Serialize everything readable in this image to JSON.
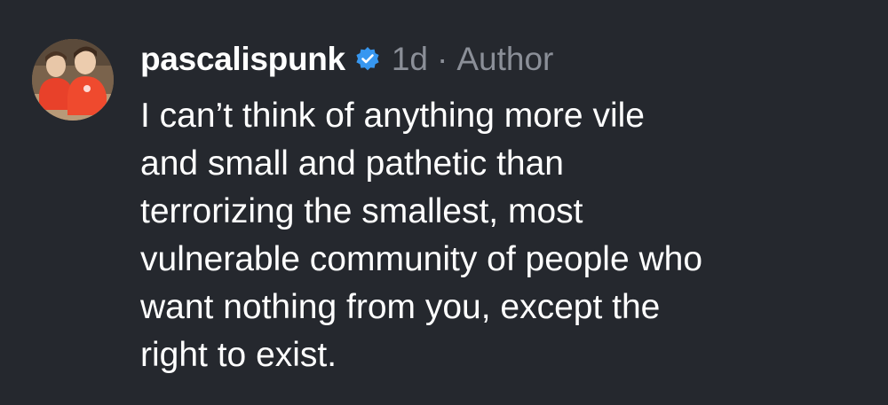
{
  "comment": {
    "username": "pascalispunk",
    "verified_icon": "verified-badge-icon",
    "time": "1d",
    "separator": "·",
    "role": "Author",
    "text_lines": [
      "I can’t think of anything more vile",
      "and small and pathetic than",
      "terrorizing the smallest, most",
      "vulnerable community of people who",
      "want nothing from you, except the",
      "right to exist."
    ]
  },
  "colors": {
    "background": "#25282e",
    "text": "#ffffff",
    "meta": "#8b8f98",
    "verified": "#3797f0"
  }
}
